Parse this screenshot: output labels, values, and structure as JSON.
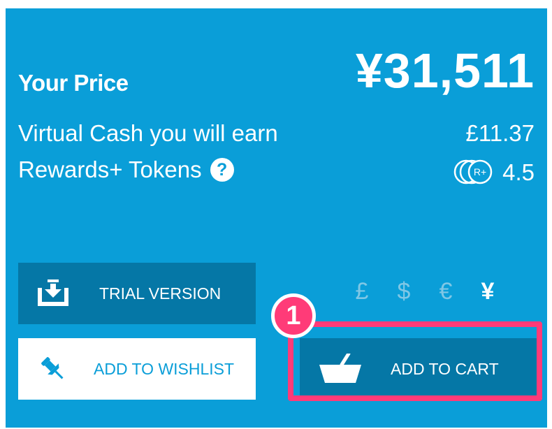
{
  "price": {
    "label": "Your Price",
    "value": "¥31,511"
  },
  "rewards": {
    "virtual_cash_label": "Virtual Cash you will earn",
    "virtual_cash_value": "£11.37",
    "tokens_label": "Rewards+ Tokens",
    "help_symbol": "?",
    "token_badge_text": "R+",
    "tokens_value": "4.5"
  },
  "buttons": {
    "trial_label": "TRIAL VERSION",
    "wishlist_label": "ADD TO WISHLIST",
    "cart_label": "ADD TO CART"
  },
  "currencies": [
    {
      "symbol": "£",
      "selected": false
    },
    {
      "symbol": "$",
      "selected": false
    },
    {
      "symbol": "€",
      "selected": false
    },
    {
      "symbol": "¥",
      "selected": true
    }
  ],
  "annotation": {
    "step_number": "1",
    "color": "#ff3b78"
  },
  "colors": {
    "panel": "#0a9ed8",
    "button_dark": "#0577a6",
    "text_light": "#ffffff"
  }
}
